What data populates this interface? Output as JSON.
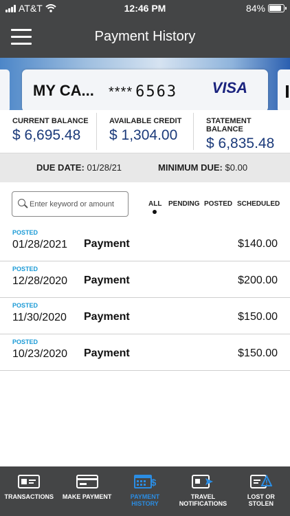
{
  "status_bar": {
    "carrier": "AT&T",
    "time": "12:46 PM",
    "battery": "84%",
    "battery_level": 0.84
  },
  "header": {
    "title": "Payment History",
    "menu_icon": "hamburger-menu-icon"
  },
  "card": {
    "name": "MY CA...",
    "number_mask": "****",
    "last4": "6563",
    "brand": "VISA"
  },
  "balances": [
    {
      "label": "CURRENT BALANCE",
      "value": "$ 6,695.48"
    },
    {
      "label": "AVAILABLE CREDIT",
      "value": "$ 1,304.00"
    },
    {
      "label": "STATEMENT BALANCE",
      "value": "$ 6,835.48"
    }
  ],
  "due": {
    "due_date_label": "DUE DATE:",
    "due_date_value": "01/28/21",
    "min_due_label": "MINIMUM DUE:",
    "min_due_value": "$0.00"
  },
  "search": {
    "placeholder": "Enter keyword or amount"
  },
  "filters": {
    "all": "ALL",
    "pending": "PENDING",
    "posted": "POSTED",
    "scheduled": "SCHEDULED",
    "selected": "ALL"
  },
  "transactions": [
    {
      "status": "POSTED",
      "date": "01/28/2021",
      "description": "Payment",
      "amount": "$140.00"
    },
    {
      "status": "POSTED",
      "date": "12/28/2020",
      "description": "Payment",
      "amount": "$200.00"
    },
    {
      "status": "POSTED",
      "date": "11/30/2020",
      "description": "Payment",
      "amount": "$150.00"
    },
    {
      "status": "POSTED",
      "date": "10/23/2020",
      "description": "Payment",
      "amount": "$150.00"
    }
  ],
  "bottom_nav": [
    {
      "label_1": "TRANSACTIONS",
      "label_2": "",
      "icon": "card-list-icon",
      "active": false
    },
    {
      "label_1": "MAKE PAYMENT",
      "label_2": "",
      "icon": "card-payment-icon",
      "active": false
    },
    {
      "label_1": "PAYMENT",
      "label_2": "HISTORY",
      "icon": "calendar-dollar-icon",
      "active": true
    },
    {
      "label_1": "TRAVEL",
      "label_2": "NOTIFICATIONS",
      "icon": "card-plane-icon",
      "active": false
    },
    {
      "label_1": "LOST OR",
      "label_2": "STOLEN",
      "icon": "card-warning-icon",
      "active": false
    }
  ],
  "colors": {
    "header_bg": "#444546",
    "balance_value": "#1b3a7a",
    "status_posted": "#1a9ad6",
    "nav_active": "#2b8de3"
  }
}
